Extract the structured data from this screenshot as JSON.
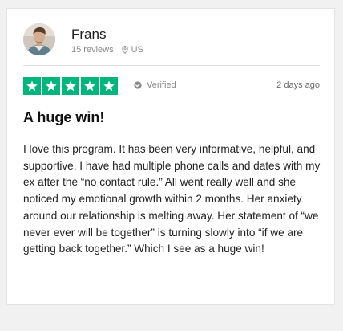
{
  "reviewer": {
    "name": "Frans",
    "review_count": "15 reviews",
    "country": "US",
    "avatar_icon": "person-avatar-icon",
    "location_icon": "map-pin-icon"
  },
  "review": {
    "rating": 5,
    "rating_max": 5,
    "star_color": "#00b67a",
    "verified_label": "Verified",
    "date": "2 days ago",
    "title": "A huge win!",
    "body": "I love this program. It has been very informative, helpful, and supportive. I have had multiple phone calls and dates with my ex after the “no contact rule.” All went really well and she noticed my emotional growth within 2 months. Her anxiety around our relationship is melting away. Her statement of “we never ever will be together” is turning slowly into “if we are getting back together.” Which I see as a huge win!"
  }
}
